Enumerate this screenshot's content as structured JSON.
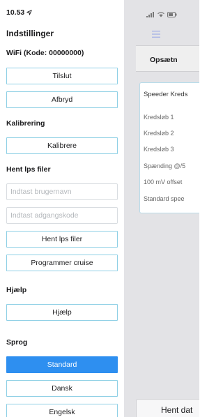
{
  "status_bar": {
    "time": "10.53"
  },
  "drawer": {
    "title": "Indstillinger",
    "wifi": {
      "label": "WiFi (Kode: 00000000)",
      "connect": "Tilslut",
      "disconnect": "Afbryd"
    },
    "calibration": {
      "label": "Kalibrering",
      "calibrate": "Kalibrere"
    },
    "fetch_lps": {
      "label": "Hent lps filer",
      "username_placeholder": "Indtast brugernavn",
      "password_placeholder": "Indtast adgangskode",
      "fetch_button": "Hent lps filer",
      "program_cruise": "Programmer cruise"
    },
    "help": {
      "label": "Hjælp",
      "button": "Hjælp"
    },
    "language": {
      "label": "Sprog",
      "options": [
        "Standard",
        "Dansk",
        "Engelsk"
      ],
      "selected": "Standard"
    }
  },
  "background": {
    "page_title": "Opsætn",
    "panel_title": "Speeder Kreds",
    "rows": [
      "Kredsløb 1",
      "Kredsløb 2",
      "Kredsløb 3",
      "Spænding @/5",
      "100 mV offset",
      "Standard spee"
    ],
    "bottom_button": "Hent dat"
  },
  "colors": {
    "accent": "#2e8ff0",
    "button_border": "#8fd0e5"
  }
}
